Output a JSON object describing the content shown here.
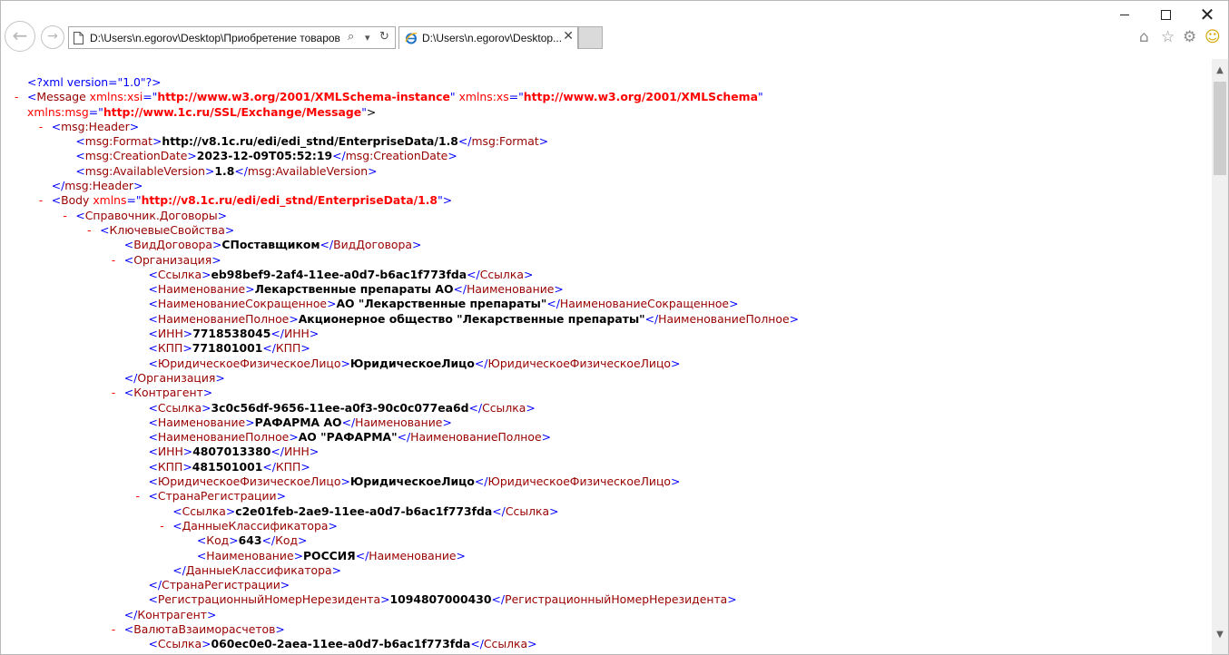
{
  "window": {
    "controls": {
      "minimize": "",
      "maximize": "",
      "close": "✕"
    }
  },
  "toolbar": {
    "back_icon": "arrow-left-icon",
    "forward_icon": "arrow-right-icon",
    "address_url": "D:\\Users\\n.egorov\\Desktop\\Приобретение товаров",
    "search_glyph": "⌕",
    "dropdown_glyph": "▾",
    "refresh_glyph": "↻",
    "tab_title": "D:\\Users\\n.egorov\\Desktop...",
    "tab_close": "✕",
    "home_glyph": "⌂",
    "favorites_glyph": "☆",
    "settings_glyph": "⚙",
    "smile_glyph": "☺"
  },
  "xml_lines": [
    {
      "dash": "",
      "text": "<?xml version=\"1.0\"?>"
    },
    {
      "dash": "-",
      "text": "<Message xmlns:xsi=\"http://www.w3.org/2001/XMLSchema-instance\" xmlns:xs=\"http://www.w3.org/2001/XMLSchema\""
    },
    {
      "dash": "",
      "text": "xmlns:msg=\"http://www.1c.ru/SSL/Exchange/Message\">"
    },
    {
      "dash": "-",
      "text": "<msg:Header>"
    },
    {
      "dash": "",
      "text": "<msg:Format>http://v8.1c.ru/edi/edi_stnd/EnterpriseData/1.8</msg:Format>"
    },
    {
      "dash": "",
      "text": "<msg:CreationDate>2023-12-09T05:52:19</msg:CreationDate>"
    },
    {
      "dash": "",
      "text": "<msg:AvailableVersion>1.8</msg:AvailableVersion>"
    },
    {
      "dash": "",
      "text": "</msg:Header>"
    },
    {
      "dash": "-",
      "text": "<Body xmlns=\"http://v8.1c.ru/edi/edi_stnd/EnterpriseData/1.8\">"
    },
    {
      "dash": "-",
      "text": "<Справочник.Договоры>"
    },
    {
      "dash": "-",
      "text": "<КлючевыеСвойства>"
    },
    {
      "dash": "",
      "text": "<ВидДоговора>СПоставщиком</ВидДоговора>"
    },
    {
      "dash": "-",
      "text": "<Организация>"
    },
    {
      "dash": "",
      "text": "<Ссылка>eb98bef9-2af4-11ee-a0d7-b6ac1f773fda</Ссылка>"
    },
    {
      "dash": "",
      "text": "<Наименование>Лекарственные препараты АО</Наименование>"
    },
    {
      "dash": "",
      "text": "<НаименованиеСокращенное>АО \"Лекарственные препараты\"</НаименованиеСокращенное>"
    },
    {
      "dash": "",
      "text": "<НаименованиеПолное>Акционерное общество \"Лекарственные препараты\"</НаименованиеПолное>"
    },
    {
      "dash": "",
      "text": "<ИНН>7718538045</ИНН>"
    },
    {
      "dash": "",
      "text": "<КПП>771801001</КПП>"
    },
    {
      "dash": "",
      "text": "<ЮридическоеФизическоеЛицо>ЮридическоеЛицо</ЮридическоеФизическоеЛицо>"
    },
    {
      "dash": "",
      "text": "</Организация>"
    },
    {
      "dash": "-",
      "text": "<Контрагент>"
    },
    {
      "dash": "",
      "text": "<Ссылка>3c0c56df-9656-11ee-a0f3-90c0c077ea6d</Ссылка>"
    },
    {
      "dash": "",
      "text": "<Наименование>РАФАРМА АО</Наименование>"
    },
    {
      "dash": "",
      "text": "<НаименованиеПолное>АО \"РАФАРМА\"</НаименованиеПолное>"
    },
    {
      "dash": "",
      "text": "<ИНН>4807013380</ИНН>"
    },
    {
      "dash": "",
      "text": "<КПП>481501001</КПП>"
    },
    {
      "dash": "",
      "text": "<ЮридическоеФизическоеЛицо>ЮридическоеЛицо</ЮридическоеФизическоеЛицо>"
    },
    {
      "dash": "-",
      "text": "<СтранаРегистрации>"
    },
    {
      "dash": "",
      "text": "<Ссылка>c2e01feb-2ae9-11ee-a0d7-b6ac1f773fda</Ссылка>"
    },
    {
      "dash": "-",
      "text": "<ДанныеКлассификатора>"
    },
    {
      "dash": "",
      "text": "<Код>643</Код>"
    },
    {
      "dash": "",
      "text": "<Наименование>РОССИЯ</Наименование>"
    },
    {
      "dash": "",
      "text": "</ДанныеКлассификатора>"
    },
    {
      "dash": "",
      "text": "</СтранаРегистрации>"
    },
    {
      "dash": "",
      "text": "<РегистрационныйНомерНерезидента>1094807000430</РегистрационныйНомерНерезидента>"
    },
    {
      "dash": "",
      "text": "</Контрагент>"
    },
    {
      "dash": "-",
      "text": "<ВалютаВзаиморасчетов>"
    },
    {
      "dash": "",
      "text": "<Ссылка>060ec0e0-2aea-11ee-a0d7-b6ac1f773fda</Ссылка>"
    }
  ],
  "scrollbar": {
    "up": "▲",
    "down": "▼",
    "position_fraction": 0.04
  }
}
